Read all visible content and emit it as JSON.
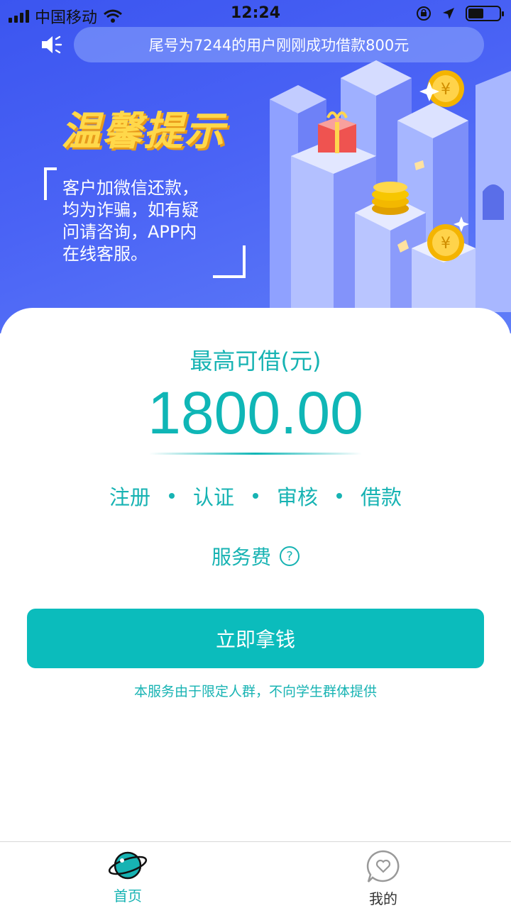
{
  "status_bar": {
    "carrier": "中国移动",
    "time": "12:24",
    "battery_level": 0.5
  },
  "banner": {
    "notice": "尾号为7244的用户刚刚成功借款800元",
    "speaker_icon": "speaker-muted-icon",
    "title": "温馨提示",
    "tip_lines": [
      "客户加微信还款，",
      "均为诈骗，如有疑",
      "问请咨询，APP内",
      "在线客服。"
    ]
  },
  "loan": {
    "max_label": "最高可借(元)",
    "amount": "1800.00",
    "steps": [
      "注册",
      "认证",
      "审核",
      "借款"
    ],
    "fee_label": "服务费",
    "fee_help_icon": "question-circle-icon",
    "button_label": "立即拿钱",
    "disclaimer": "本服务由于限定人群，不向学生群体提供"
  },
  "tabbar": {
    "items": [
      {
        "label": "首页",
        "icon": "planet-icon",
        "active": true
      },
      {
        "label": "我的",
        "icon": "heart-bubble-icon",
        "active": false
      }
    ]
  },
  "colors": {
    "accent": "#0bbcbc",
    "banner_blue": "#4a63f5",
    "title_yellow": "#ffd84a"
  }
}
